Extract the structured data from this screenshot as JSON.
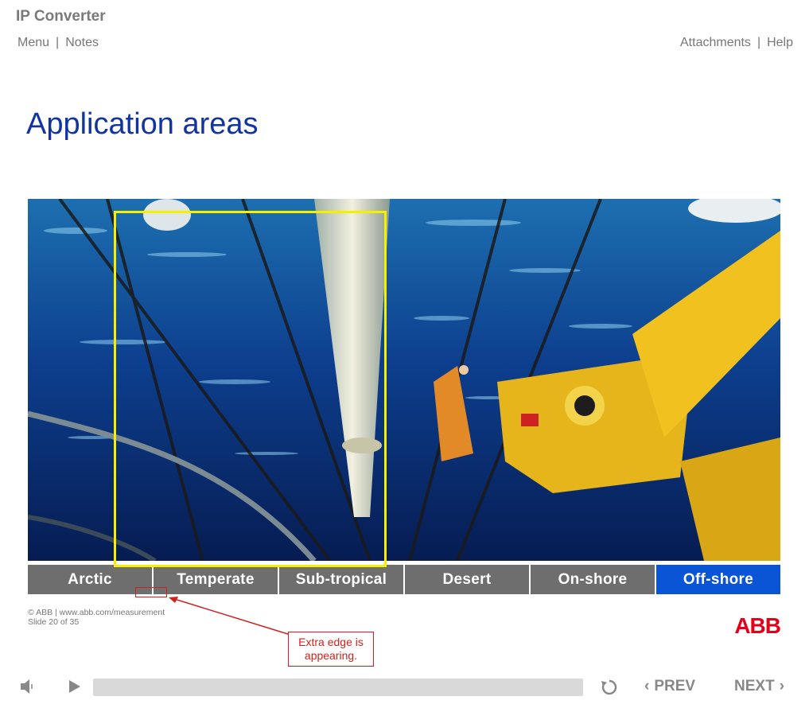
{
  "app": {
    "title": "IP Converter"
  },
  "topnav": {
    "menu": "Menu",
    "notes": "Notes",
    "attachments": "Attachments",
    "help": "Help",
    "separator": "|"
  },
  "slide": {
    "title": "Application areas",
    "photo_subject": "offshore rig platform over ocean",
    "tabs": [
      {
        "label": "Arctic",
        "active": false
      },
      {
        "label": "Temperate",
        "active": false
      },
      {
        "label": "Sub-tropical",
        "active": false
      },
      {
        "label": "Desert",
        "active": false
      },
      {
        "label": "On-shore",
        "active": false
      },
      {
        "label": "Off-shore",
        "active": true
      }
    ],
    "footer_line1": "© ABB | www.abb.com/measurement",
    "footer_line2": "Slide 20 of 35",
    "logo": "ABB"
  },
  "annotation": {
    "callout_text": "Extra edge is appearing.",
    "color": "#d0211f",
    "highlight_color": "#f4f000"
  },
  "player": {
    "prev_label": "PREV",
    "next_label": "NEXT",
    "icons": [
      "volume-icon",
      "play-icon",
      "replay-icon",
      "chevron-left-icon",
      "chevron-right-icon"
    ]
  },
  "colors": {
    "title_blue": "#1234a0",
    "tab_gray": "#6e6e6e",
    "tab_active": "#0a54d6",
    "abb_red": "#e2001a"
  }
}
